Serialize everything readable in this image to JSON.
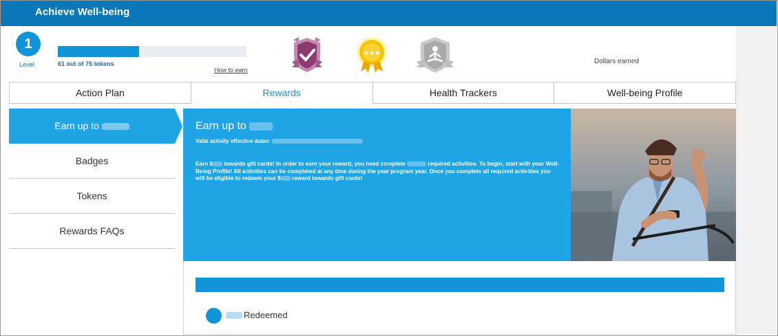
{
  "header": {
    "title": "Achieve Well-being"
  },
  "level": {
    "number": "1",
    "label": "Level"
  },
  "tokens": {
    "text": "61 out of 75 tokens",
    "earned": 61,
    "total": 75
  },
  "links": {
    "how_to_earn": "How to earn"
  },
  "badges": [
    "checkmark-shield-badge",
    "three-star-medal-badge",
    "meditation-shield-badge"
  ],
  "dollars_earned_label": "Dollars earned",
  "tabs": [
    {
      "label": "Action Plan"
    },
    {
      "label": "Rewards"
    },
    {
      "label": "Health Trackers"
    },
    {
      "label": "Well-being Profile"
    }
  ],
  "active_tab": "Rewards",
  "sidebar": {
    "items": [
      {
        "label": "Earn up to"
      },
      {
        "label": "Badges"
      },
      {
        "label": "Tokens"
      },
      {
        "label": "Rewards FAQs"
      }
    ]
  },
  "hero": {
    "heading": "Earn up to",
    "dates_label": "Valid activity effective dates:",
    "body_p1": "Earn $",
    "body_p2": " towards gift cards! In order to earn your reward, you need complete ",
    "body_p3": " required activities. To begin, start with your Well-Being Profile! All activities can be completed at any time during the year program year. Once you complete all required activities you will be eligible to redeem your $",
    "body_p4": " reward towards gift cards!"
  },
  "redemption": {
    "label": "Redeemed"
  },
  "colors": {
    "header": "#0a77b8",
    "accent": "#1295d8",
    "hero": "#1fa5e6"
  }
}
